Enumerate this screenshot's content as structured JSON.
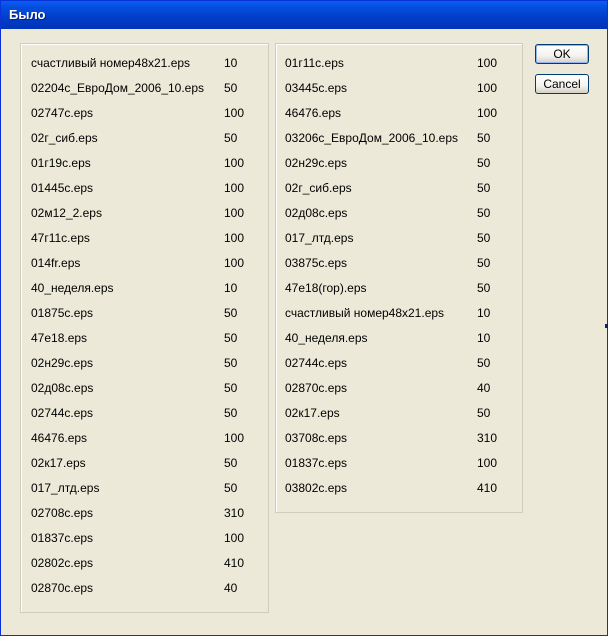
{
  "window": {
    "title": "Было"
  },
  "buttons": {
    "ok_label": "OK",
    "cancel_label": "Cancel"
  },
  "left_list": [
    {
      "name": "счастливый номер48х21.eps",
      "value": "10"
    },
    {
      "name": "02204с_ЕвроДом_2006_10.eps",
      "value": "50"
    },
    {
      "name": "02747с.eps",
      "value": "100"
    },
    {
      "name": "02г_сиб.eps",
      "value": "50"
    },
    {
      "name": "01г19с.eps",
      "value": "100"
    },
    {
      "name": "01445с.eps",
      "value": "100"
    },
    {
      "name": "02м12_2.eps",
      "value": "100"
    },
    {
      "name": "47г11с.eps",
      "value": "100"
    },
    {
      "name": "014fr.eps",
      "value": "100"
    },
    {
      "name": "40_неделя.eps",
      "value": "10"
    },
    {
      "name": "01875с.eps",
      "value": "50"
    },
    {
      "name": "47е18.eps",
      "value": "50"
    },
    {
      "name": "02н29с.eps",
      "value": "50"
    },
    {
      "name": "02д08с.eps",
      "value": "50"
    },
    {
      "name": "02744с.eps",
      "value": "50"
    },
    {
      "name": "46476.eps",
      "value": "100"
    },
    {
      "name": "02к17.eps",
      "value": "50"
    },
    {
      "name": "017_лтд.eps",
      "value": "50"
    },
    {
      "name": "02708с.eps",
      "value": "310"
    },
    {
      "name": "01837с.eps",
      "value": "100"
    },
    {
      "name": "02802с.eps",
      "value": "410"
    },
    {
      "name": "02870с.eps",
      "value": "40"
    }
  ],
  "right_list": [
    {
      "name": "01г11с.eps",
      "value": "100"
    },
    {
      "name": "03445с.eps",
      "value": "100"
    },
    {
      "name": "46476.eps",
      "value": "100"
    },
    {
      "name": "03206с_ЕвроДом_2006_10.eps",
      "value": "50"
    },
    {
      "name": "02н29с.eps",
      "value": "50"
    },
    {
      "name": "02г_сиб.eps",
      "value": "50"
    },
    {
      "name": "02д08с.eps",
      "value": "50"
    },
    {
      "name": "017_лтд.eps",
      "value": "50"
    },
    {
      "name": "03875с.eps",
      "value": "50"
    },
    {
      "name": "47е18(гор).eps",
      "value": "50"
    },
    {
      "name": "счастливый номер48х21.eps",
      "value": "10"
    },
    {
      "name": "40_неделя.eps",
      "value": "10"
    },
    {
      "name": "02744с.eps",
      "value": "50"
    },
    {
      "name": "02870с.eps",
      "value": "40"
    },
    {
      "name": "02к17.eps",
      "value": "50"
    },
    {
      "name": "03708с.eps",
      "value": "310"
    },
    {
      "name": "01837с.eps",
      "value": "100"
    },
    {
      "name": "03802с.eps",
      "value": "410"
    }
  ]
}
